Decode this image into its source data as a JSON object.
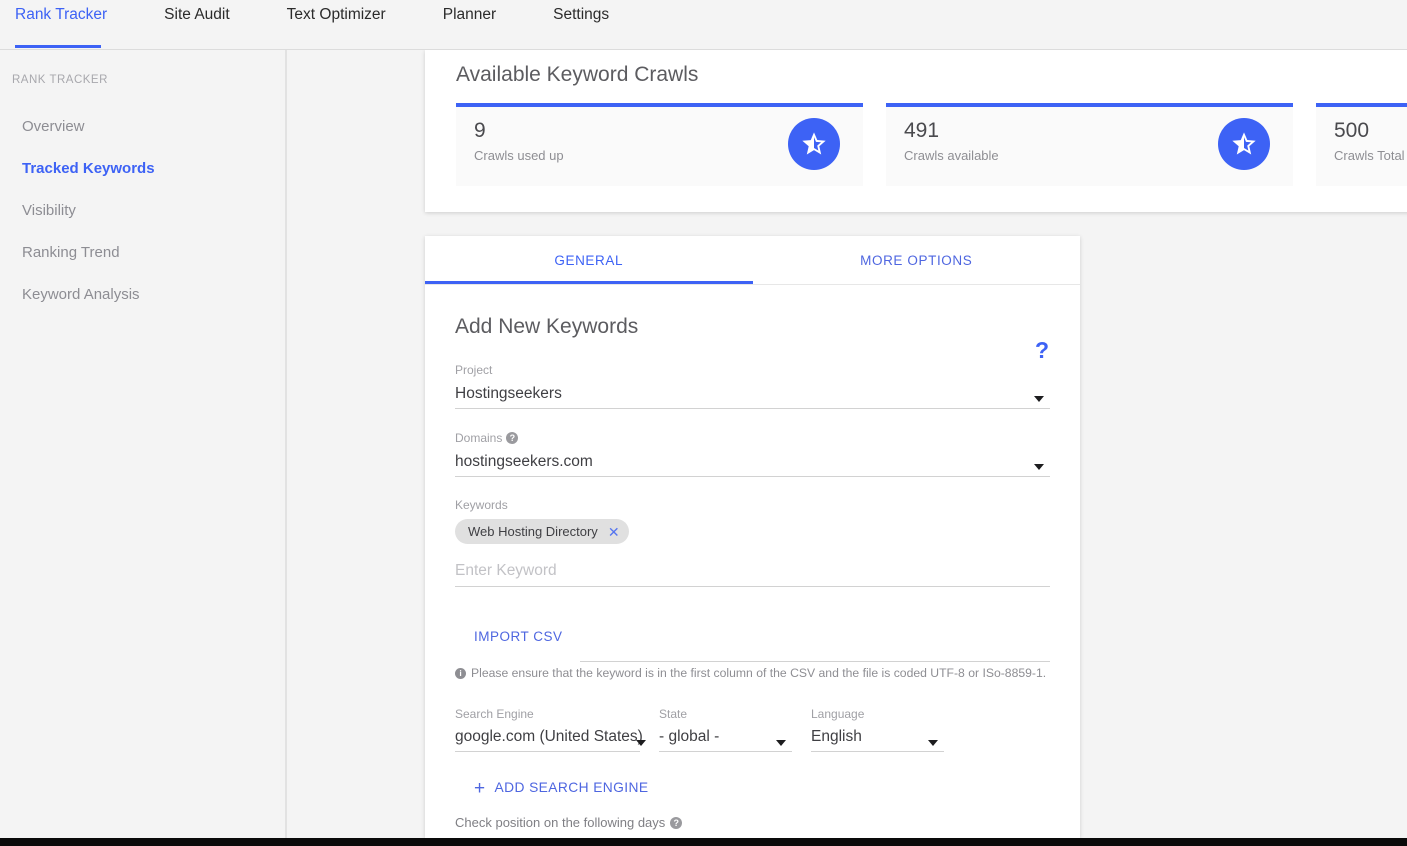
{
  "topnav": {
    "items": [
      {
        "label": "Rank Tracker",
        "active": true
      },
      {
        "label": "Site Audit",
        "active": false
      },
      {
        "label": "Text Optimizer",
        "active": false
      },
      {
        "label": "Planner",
        "active": false
      },
      {
        "label": "Settings",
        "active": false
      }
    ]
  },
  "sidebar": {
    "heading": "RANK TRACKER",
    "items": [
      {
        "label": "Overview",
        "active": false
      },
      {
        "label": "Tracked Keywords",
        "active": true
      },
      {
        "label": "Visibility",
        "active": false
      },
      {
        "label": "Ranking Trend",
        "active": false
      },
      {
        "label": "Keyword Analysis",
        "active": false
      }
    ]
  },
  "crawls": {
    "title": "Available Keyword Crawls",
    "stats": [
      {
        "value": "9",
        "label": "Crawls used up",
        "icon": "star-half-icon"
      },
      {
        "value": "491",
        "label": "Crawls available",
        "icon": "star-half-icon"
      },
      {
        "value": "500",
        "label": "Crawls Total",
        "icon": "star-half-icon"
      }
    ]
  },
  "form": {
    "tabs": [
      {
        "label": "GENERAL",
        "active": true
      },
      {
        "label": "MORE OPTIONS",
        "active": false
      }
    ],
    "title": "Add New Keywords",
    "help_symbol": "?",
    "project": {
      "label": "Project",
      "value": "Hostingseekers"
    },
    "domains": {
      "label": "Domains",
      "value": "hostingseekers.com",
      "help_symbol": "?"
    },
    "keywords": {
      "label": "Keywords",
      "chips": [
        "Web Hosting Directory"
      ],
      "chip_remove_symbol": "✕",
      "input_placeholder": "Enter Keyword",
      "input_value": ""
    },
    "import": {
      "button_label": "IMPORT CSV",
      "note": "Please ensure that the keyword is in the first column of the CSV and the file is coded UTF-8 or ISo-8859-1.",
      "note_icon_symbol": "i"
    },
    "search_engine": {
      "label": "Search Engine",
      "value": "google.com (United States)"
    },
    "state": {
      "label": "State",
      "value": "- global -"
    },
    "language": {
      "label": "Language",
      "value": "English"
    },
    "add_search_engine": {
      "label": "ADD SEARCH ENGINE",
      "plus_symbol": "+"
    },
    "check_days": {
      "label": "Check position on the following days",
      "help_symbol": "?"
    }
  },
  "colors": {
    "accent": "#3d62f5",
    "link": "#4e66e0",
    "page_bg": "#f4f4f4",
    "card_bg": "#ffffff",
    "stat_bg": "#fafafa",
    "text_primary": "#3f3f43",
    "text_muted": "#8e8e93",
    "chip_bg": "#e0e0e0"
  }
}
